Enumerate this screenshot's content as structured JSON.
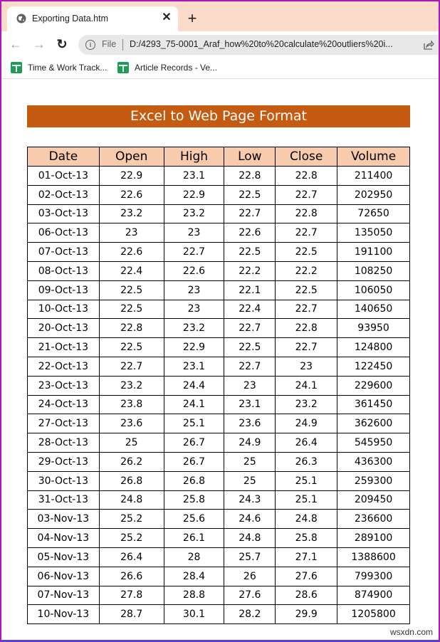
{
  "browser": {
    "tab": {
      "title": "Exporting Data.htm",
      "icon": "globe-icon",
      "close": "✕"
    },
    "new_tab": "+",
    "nav": {
      "back": "←",
      "forward": "→",
      "reload": "↻"
    },
    "omnibox": {
      "info": "i",
      "scheme_label": "File",
      "url": "D:/4293_75-0001_Araf_how%20to%20calculate%20outliers%20i..."
    },
    "bookmarks": [
      {
        "label": "Time & Work Track...",
        "icon": "google-sheets-icon"
      },
      {
        "label": "Article Records - Ve...",
        "icon": "google-sheets-icon"
      }
    ]
  },
  "page": {
    "banner": "Excel to Web Page Format",
    "table": {
      "headers": [
        "Date",
        "Open",
        "High",
        "Low",
        "Close",
        "Volume"
      ],
      "rows": [
        [
          "01-Oct-13",
          "22.9",
          "23.1",
          "22.8",
          "22.8",
          "211400"
        ],
        [
          "02-Oct-13",
          "22.6",
          "22.9",
          "22.5",
          "22.7",
          "202950"
        ],
        [
          "03-Oct-13",
          "23.2",
          "23.2",
          "22.7",
          "22.8",
          "72650"
        ],
        [
          "06-Oct-13",
          "23",
          "23",
          "22.6",
          "22.7",
          "135050"
        ],
        [
          "07-Oct-13",
          "22.6",
          "22.7",
          "22.5",
          "22.5",
          "191100"
        ],
        [
          "08-Oct-13",
          "22.4",
          "22.6",
          "22.2",
          "22.2",
          "108250"
        ],
        [
          "09-Oct-13",
          "22.5",
          "23",
          "22.1",
          "22.5",
          "106050"
        ],
        [
          "10-Oct-13",
          "22.5",
          "23",
          "22.4",
          "22.7",
          "140650"
        ],
        [
          "20-Oct-13",
          "22.8",
          "23.2",
          "22.7",
          "22.8",
          "93950"
        ],
        [
          "21-Oct-13",
          "22.5",
          "22.9",
          "22.5",
          "22.7",
          "124800"
        ],
        [
          "22-Oct-13",
          "22.7",
          "23.1",
          "22.7",
          "23",
          "122450"
        ],
        [
          "23-Oct-13",
          "23.2",
          "24.4",
          "23",
          "24.1",
          "229600"
        ],
        [
          "24-Oct-13",
          "23.8",
          "24.1",
          "23.1",
          "23.2",
          "361450"
        ],
        [
          "27-Oct-13",
          "23.6",
          "25.1",
          "23.6",
          "24.9",
          "362600"
        ],
        [
          "28-Oct-13",
          "25",
          "26.7",
          "24.9",
          "26.4",
          "545950"
        ],
        [
          "29-Oct-13",
          "26.2",
          "26.7",
          "25",
          "26.3",
          "436300"
        ],
        [
          "30-Oct-13",
          "26.8",
          "26.8",
          "25",
          "25.1",
          "259300"
        ],
        [
          "31-Oct-13",
          "24.8",
          "25.8",
          "24.3",
          "25.1",
          "209450"
        ],
        [
          "03-Nov-13",
          "25.2",
          "25.6",
          "24.6",
          "24.8",
          "236600"
        ],
        [
          "04-Nov-13",
          "25.2",
          "26.1",
          "24.8",
          "25.8",
          "289100"
        ],
        [
          "05-Nov-13",
          "26.4",
          "28",
          "25.7",
          "27.1",
          "1388600"
        ],
        [
          "06-Nov-13",
          "26.6",
          "28.4",
          "26",
          "27.6",
          "799300"
        ],
        [
          "07-Nov-13",
          "27.8",
          "28.8",
          "27.6",
          "28.6",
          "874900"
        ],
        [
          "10-Nov-13",
          "28.7",
          "30.1",
          "28.2",
          "29.9",
          "1205800"
        ]
      ]
    }
  },
  "watermark": "wsxdn.com",
  "colors": {
    "tabstrip": "#fbdccb",
    "banner": "#c55a11",
    "header_fill": "#f8cbad"
  }
}
